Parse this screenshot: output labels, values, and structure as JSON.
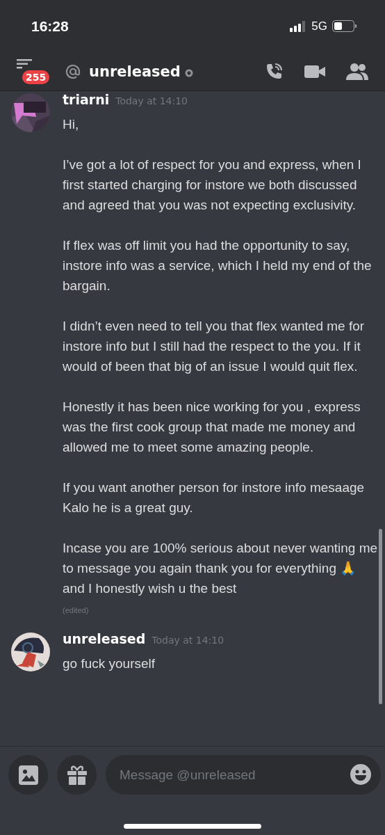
{
  "status_bar": {
    "time": "16:28",
    "network": "5G"
  },
  "header": {
    "unread_badge": "255",
    "channel_name": "unreleased",
    "online": false
  },
  "messages": [
    {
      "author": "triarni",
      "timestamp": "Today at 14:10",
      "edited_label": "(edited)",
      "paragraphs": [
        "Hi,",
        "I’ve got a lot of respect for you and express, when I first started charging for instore we both discussed and agreed that you was not expecting exclusivity.",
        "If flex was off limit you had the opportunity to say, instore info was a service, which I held my end of the bargain.",
        "I didn’t even need to tell you that flex wanted me for instore info but I still had the respect to the you. If it would of been that big of an issue I would quit flex.",
        "Honestly it has been nice working for you , express was the first cook group that made me money and allowed me to meet some amazing people.",
        "If you want another person for instore info mesaage Kalo he is a great guy.",
        "Incase you are 100% serious about never wanting me to message you again thank you for everything 🙏 and I honestly wish u the best"
      ]
    },
    {
      "author": "unreleased",
      "timestamp": "Today at 14:10",
      "paragraphs": [
        "go fuck yourself"
      ]
    }
  ],
  "composer": {
    "placeholder": "Message @unreleased"
  }
}
